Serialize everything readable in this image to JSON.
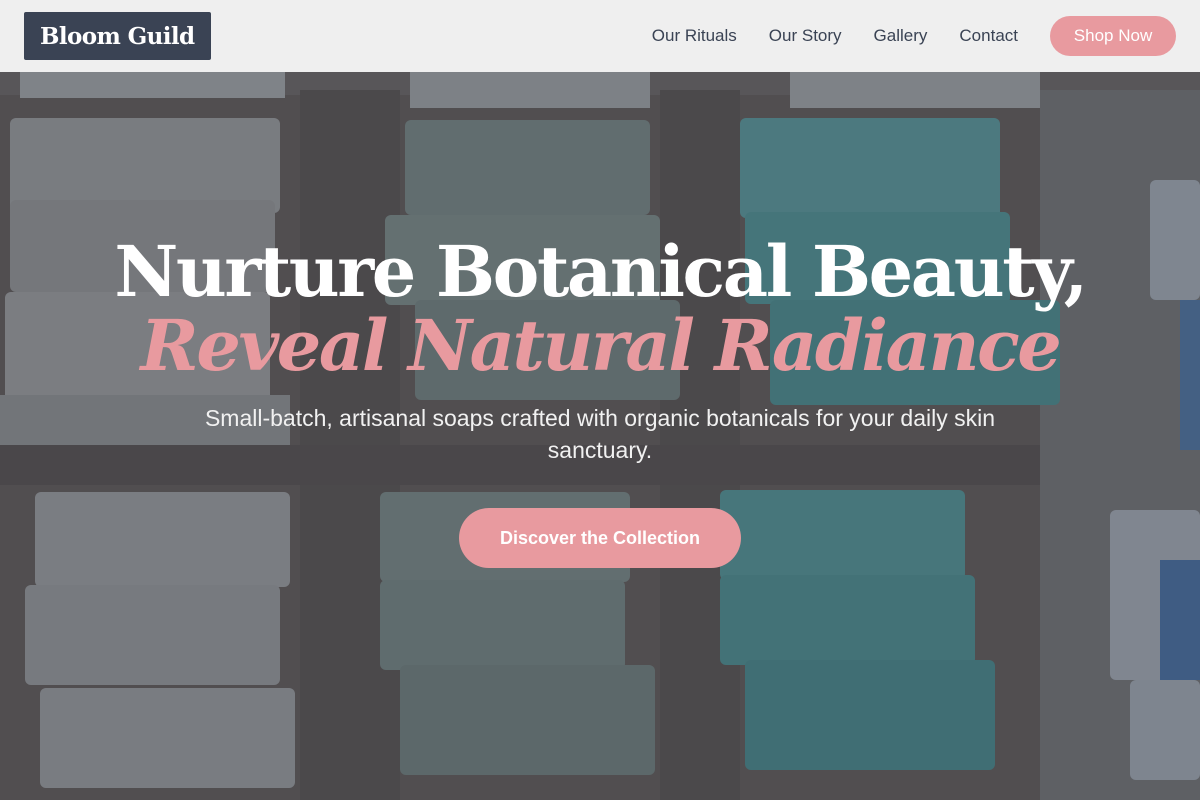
{
  "header": {
    "logo": "Bloom Guild",
    "nav": [
      {
        "label": "Our Rituals"
      },
      {
        "label": "Our Story"
      },
      {
        "label": "Gallery"
      },
      {
        "label": "Contact"
      }
    ],
    "shop_button": "Shop Now"
  },
  "hero": {
    "headline_line1": "Nurture Botanical Beauty,",
    "headline_line2": "Reveal Natural Radiance",
    "subtitle": "Small-batch, artisanal soaps crafted with organic botanicals for your daily skin sanctuary.",
    "cta": "Discover the Collection"
  },
  "colors": {
    "accent": "#e89a9f",
    "logo_bg": "#3a4354",
    "nav_text": "#3a4354",
    "header_bg": "#f8f8f8"
  }
}
